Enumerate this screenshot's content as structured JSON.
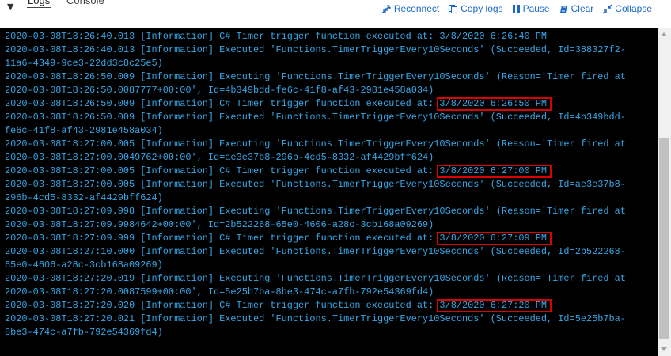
{
  "tabs": {
    "logs": "Logs",
    "console": "Console"
  },
  "toolbar": {
    "actions": [
      {
        "label": "Reconnect",
        "icon": "reconnect-icon"
      },
      {
        "label": "Copy logs",
        "icon": "copy-icon"
      },
      {
        "label": "Pause",
        "icon": "pause-icon"
      },
      {
        "label": "Clear",
        "icon": "clear-icon"
      },
      {
        "label": "Collapse",
        "icon": "collapse-icon"
      }
    ],
    "accent_color": "#1b6ac9"
  },
  "console": {
    "text_color": "#36a6e6",
    "highlight_color": "#d90000",
    "lines": [
      "2020-03-08T18:26:40.013 [Information] C# Timer trigger function executed at: 3/8/2020 6:26:40 PM",
      "2020-03-08T18:26:40.013 [Information] Executed 'Functions.TimerTriggerEvery10Seconds' (Succeeded, Id=388327f2-",
      "11a6-4349-9ce3-22dd3c8c25e5)",
      "2020-03-08T18:26:50.009 [Information] Executing 'Functions.TimerTriggerEvery10Seconds' (Reason='Timer fired at",
      "2020-03-08T18:26:50.0087777+00:00', Id=4b349bdd-fe6c-41f8-af43-2981e458a034)",
      "2020-03-08T18:26:50.009 [Information] C# Timer trigger function executed at: 3/8/2020 6:26:50 PM",
      "2020-03-08T18:26:50.009 [Information] Executed 'Functions.TimerTriggerEvery10Seconds' (Succeeded, Id=4b349bdd-",
      "fe6c-41f8-af43-2981e458a034)",
      "2020-03-08T18:27:00.005 [Information] Executing 'Functions.TimerTriggerEvery10Seconds' (Reason='Timer fired at",
      "2020-03-08T18:27:00.0049762+00:00', Id=ae3e37b8-296b-4cd5-8332-af4429bff624)",
      "2020-03-08T18:27:00.005 [Information] C# Timer trigger function executed at: 3/8/2020 6:27:00 PM",
      "2020-03-08T18:27:00.005 [Information] Executed 'Functions.TimerTriggerEvery10Seconds' (Succeeded, Id=ae3e37b8-",
      "296b-4cd5-8332-af4429bff624)",
      "2020-03-08T18:27:09.998 [Information] Executing 'Functions.TimerTriggerEvery10Seconds' (Reason='Timer fired at",
      "2020-03-08T18:27:09.9984642+00:00', Id=2b522268-65e0-4606-a28c-3cb168a09269)",
      "2020-03-08T18:27:09.999 [Information] C# Timer trigger function executed at: 3/8/2020 6:27:09 PM",
      "2020-03-08T18:27:10.000 [Information] Executed 'Functions.TimerTriggerEvery10Seconds' (Succeeded, Id=2b522268-",
      "65e0-4606-a28c-3cb168a09269)",
      "2020-03-08T18:27:20.019 [Information] Executing 'Functions.TimerTriggerEvery10Seconds' (Reason='Timer fired at",
      "2020-03-08T18:27:20.0087599+00:00', Id=5e25b7ba-8be3-474c-a7fb-792e54369fd4)",
      "2020-03-08T18:27:20.020 [Information] C# Timer trigger function executed at: 3/8/2020 6:27:20 PM",
      "2020-03-08T18:27:20.021 [Information] Executed 'Functions.TimerTriggerEvery10Seconds' (Succeeded, Id=5e25b7ba-",
      "8be3-474c-a7fb-792e54369fd4)"
    ],
    "highlighted_lines": [
      5,
      10,
      15,
      20
    ]
  }
}
